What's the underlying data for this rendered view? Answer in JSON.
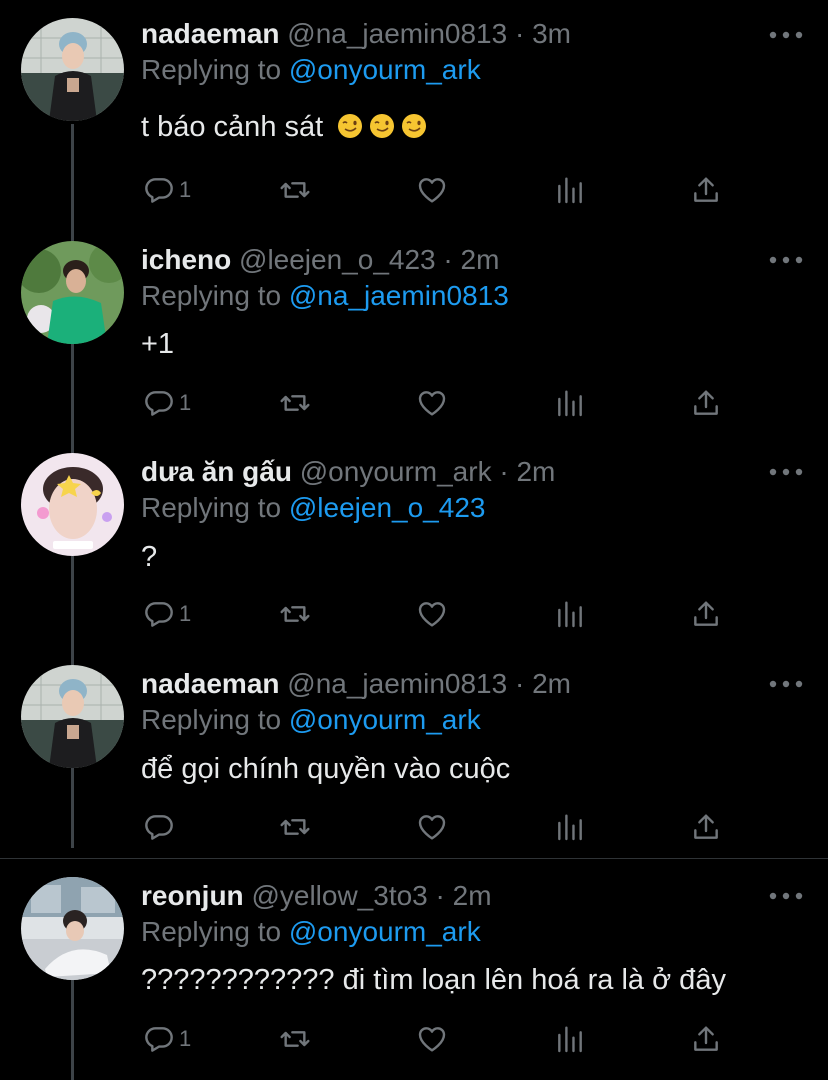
{
  "tweets": [
    {
      "display_name": "nadaeman",
      "handle": "@na_jaemin0813",
      "sep": "·",
      "time": "3m",
      "replying_prefix": "Replying to ",
      "replying_to": "@onyourm_ark",
      "text": "t báo cảnh sát",
      "emoji": [
        "winking-face",
        "winking-face",
        "winking-face"
      ],
      "reply_count": "1"
    },
    {
      "display_name": "icheno",
      "handle": "@leejen_o_423",
      "sep": "·",
      "time": "2m",
      "replying_prefix": "Replying to ",
      "replying_to": "@na_jaemin0813",
      "text": "+1",
      "reply_count": "1"
    },
    {
      "display_name": "dưa ăn gấu",
      "handle": "@onyourm_ark",
      "sep": "·",
      "time": "2m",
      "replying_prefix": "Replying to ",
      "replying_to": "@leejen_o_423",
      "text": "?",
      "reply_count": "1"
    },
    {
      "display_name": "nadaeman",
      "handle": "@na_jaemin0813",
      "sep": "·",
      "time": "2m",
      "replying_prefix": "Replying to ",
      "replying_to": "@onyourm_ark",
      "text": "để gọi chính quyền vào cuộc",
      "reply_count": ""
    },
    {
      "display_name": "reonjun",
      "handle": "@yellow_3to3",
      "sep": "·",
      "time": "2m",
      "replying_prefix": "Replying to ",
      "replying_to": "@onyourm_ark",
      "text": "???????????? đi tìm loạn lên hoá ra là ở đây",
      "reply_count": "1"
    }
  ],
  "icons": {
    "reply": "comment-bubble-icon",
    "retweet": "retweet-icon",
    "like": "heart-icon",
    "stats": "bar-chart-icon",
    "share": "share-upload-icon",
    "more": "more-dots-icon"
  },
  "colors": {
    "background": "#000000",
    "text": "#e7e9ea",
    "secondary": "#71767b",
    "link": "#1d9bf0",
    "thread_line": "#3d4348",
    "divider": "#2f3336"
  }
}
